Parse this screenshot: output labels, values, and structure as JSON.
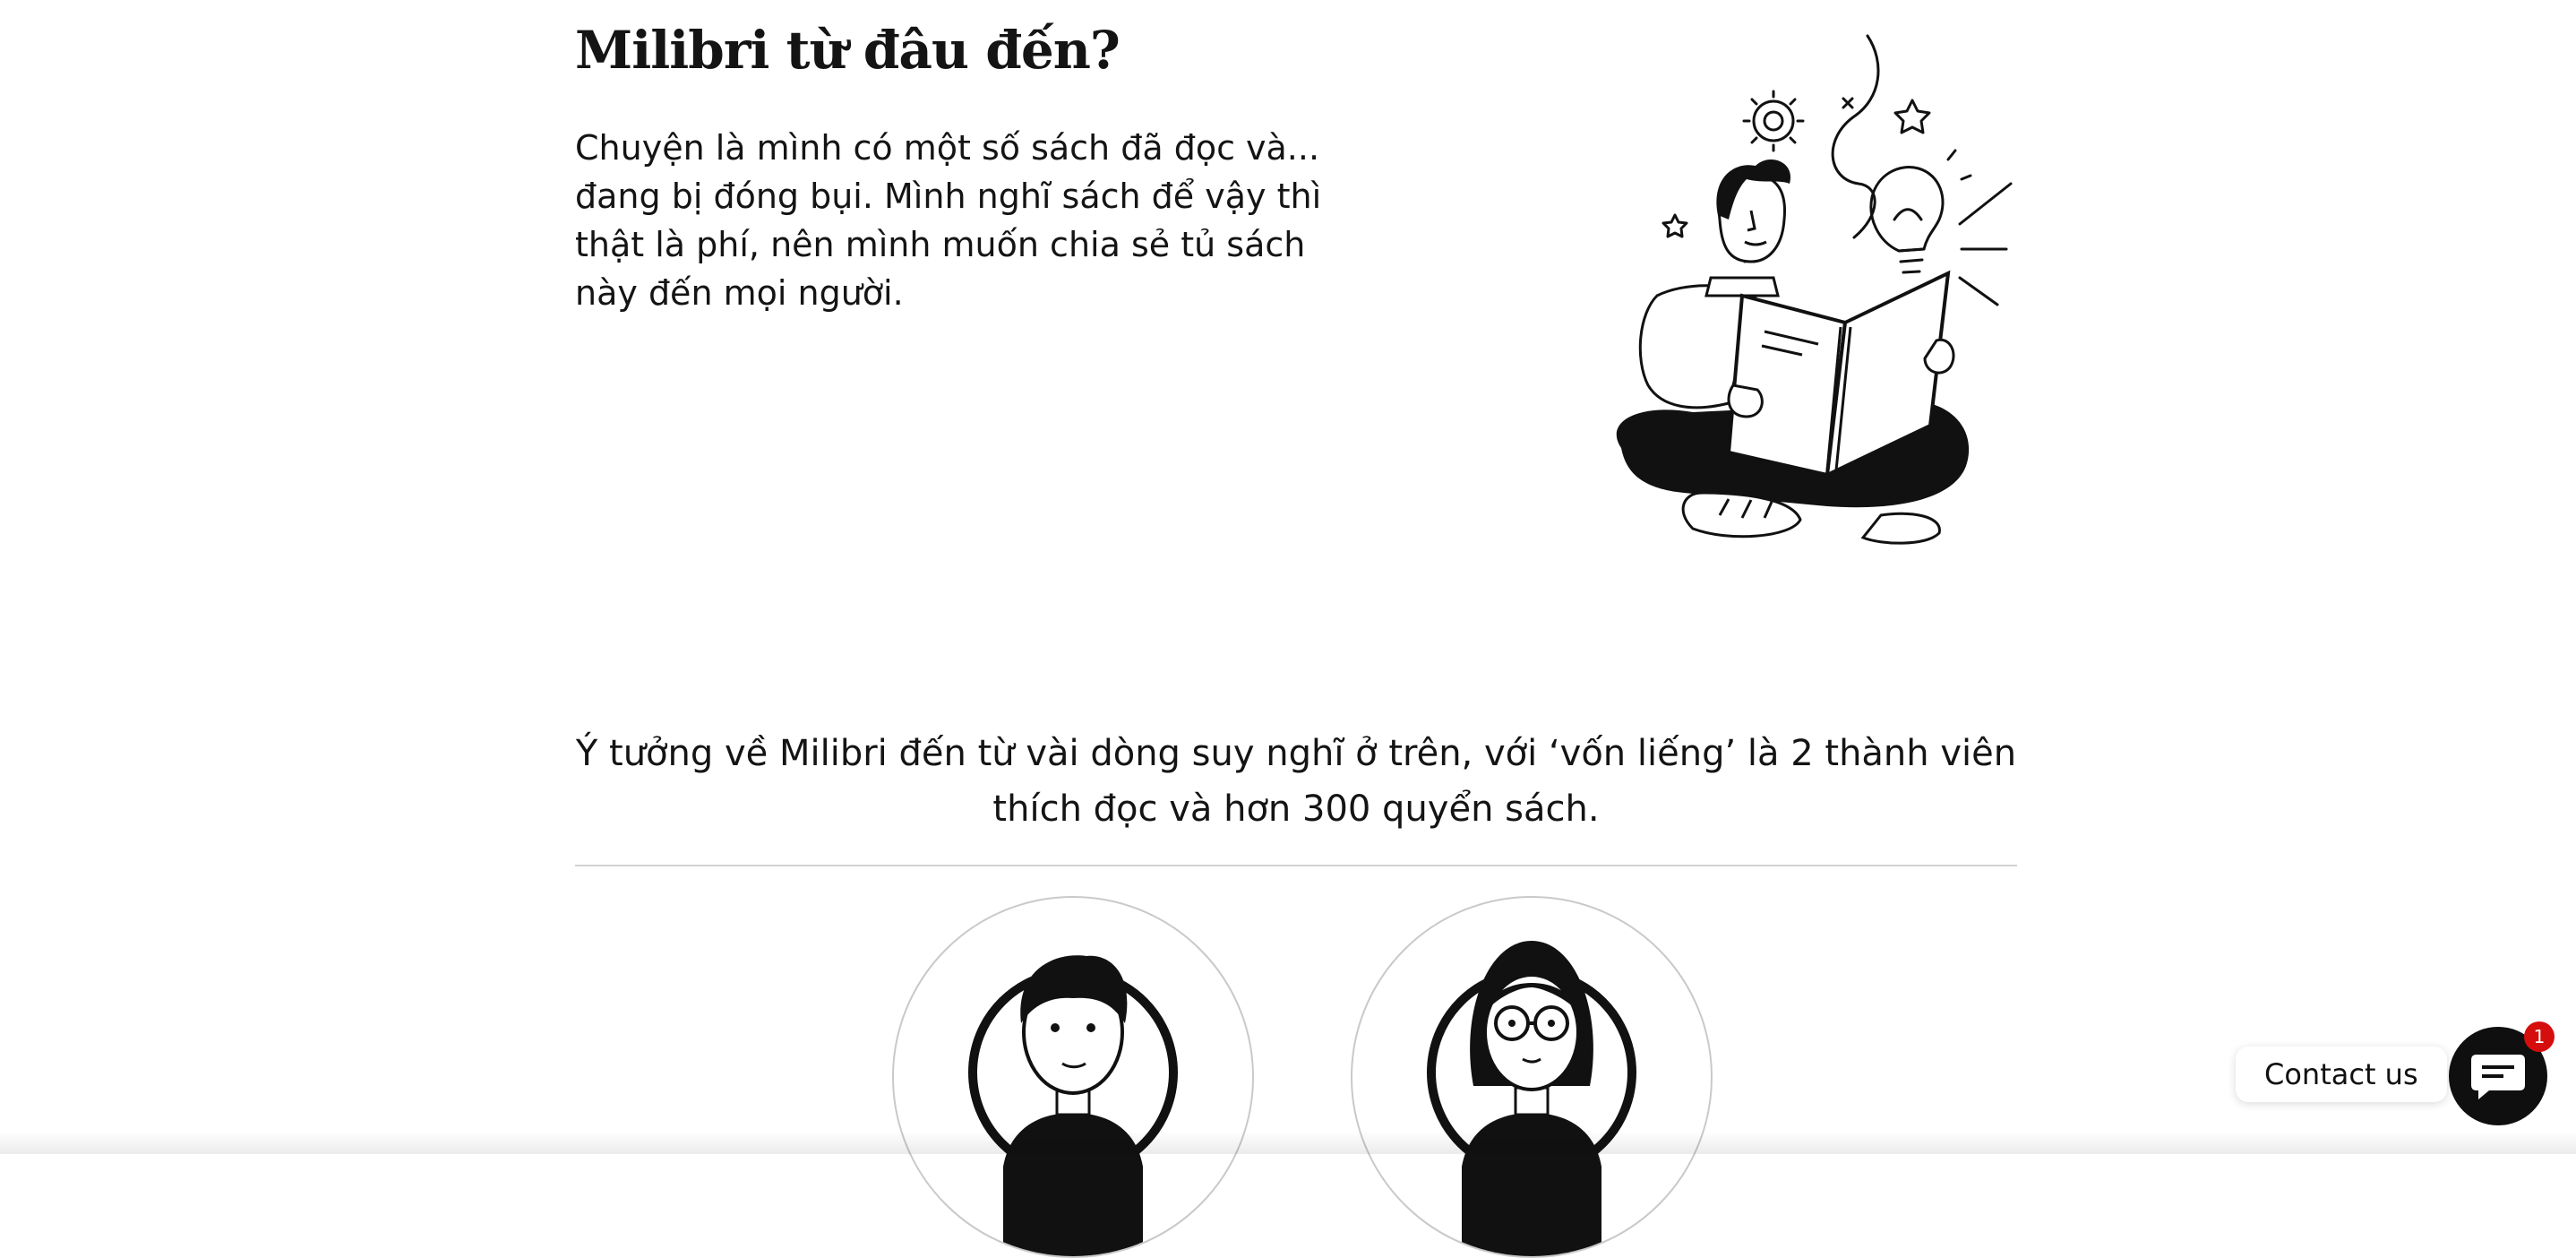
{
  "about": {
    "title": "Milibri từ đâu đến?",
    "intro": "Chuyện là mình có một số sách đã đọc và... đang bị đóng bụi. Mình nghĩ sách để vậy thì thật là phí, nên mình muốn chia sẻ tủ sách này đến mọi người.",
    "idea": "Ý tưởng về Milibri đến từ vài dòng suy nghĩ ở trên, với ‘vốn liếng’ là 2 thành viên thích đọc và hơn 300 quyển sách."
  },
  "contact": {
    "label": "Contact us",
    "badge_count": "1",
    "icon": "chat-icon",
    "badge_color": "#d60d0d"
  },
  "colors": {
    "text": "#141414",
    "background": "#ffffff",
    "divider": "#d2d2d2"
  }
}
